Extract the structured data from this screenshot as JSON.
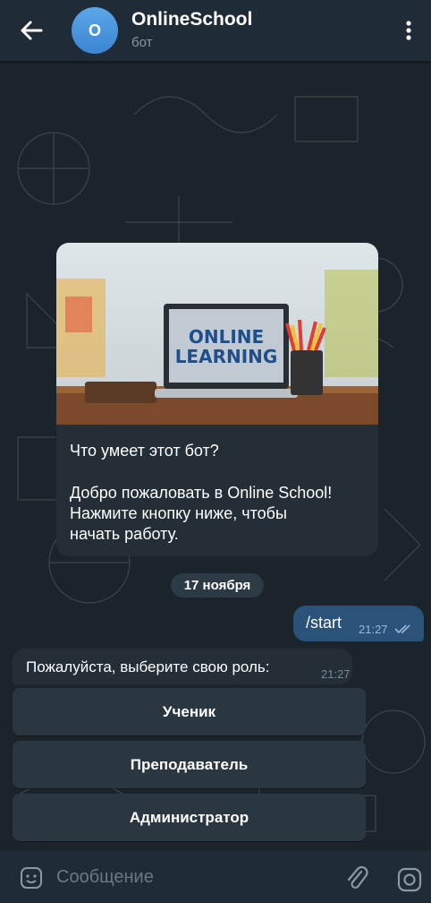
{
  "header": {
    "title": "OnlineSchool",
    "subtitle": "бот",
    "avatar_letter": "O",
    "back_icon": "arrow-left-icon",
    "menu_icon": "more-vertical-icon"
  },
  "intro": {
    "image_text_line1": "ONLINE",
    "image_text_line2": "LEARNING",
    "title": "Что умеет этот бот?",
    "text_line1": "Добро пожаловать в Online School!",
    "text_line2": "Нажмите кнопку ниже, чтобы",
    "text_line3": "начать работу."
  },
  "date_label": "17 ноября",
  "outgoing": {
    "text": "/start",
    "time": "21:27"
  },
  "incoming": {
    "text": "Пожалуйста, выберите свою роль:",
    "time": "21:27"
  },
  "keyboard": [
    {
      "label": "Ученик"
    },
    {
      "label": "Преподаватель"
    },
    {
      "label": "Администратор"
    }
  ],
  "composer": {
    "placeholder": "Сообщение",
    "emoji_icon": "emoji-icon",
    "attach_icon": "paperclip-icon",
    "camera_icon": "camera-icon"
  },
  "colors": {
    "header_bg": "#1f2b36",
    "bubble_in": "#232e37",
    "bubble_out": "#2b5278",
    "avatar": "#4a95de"
  }
}
